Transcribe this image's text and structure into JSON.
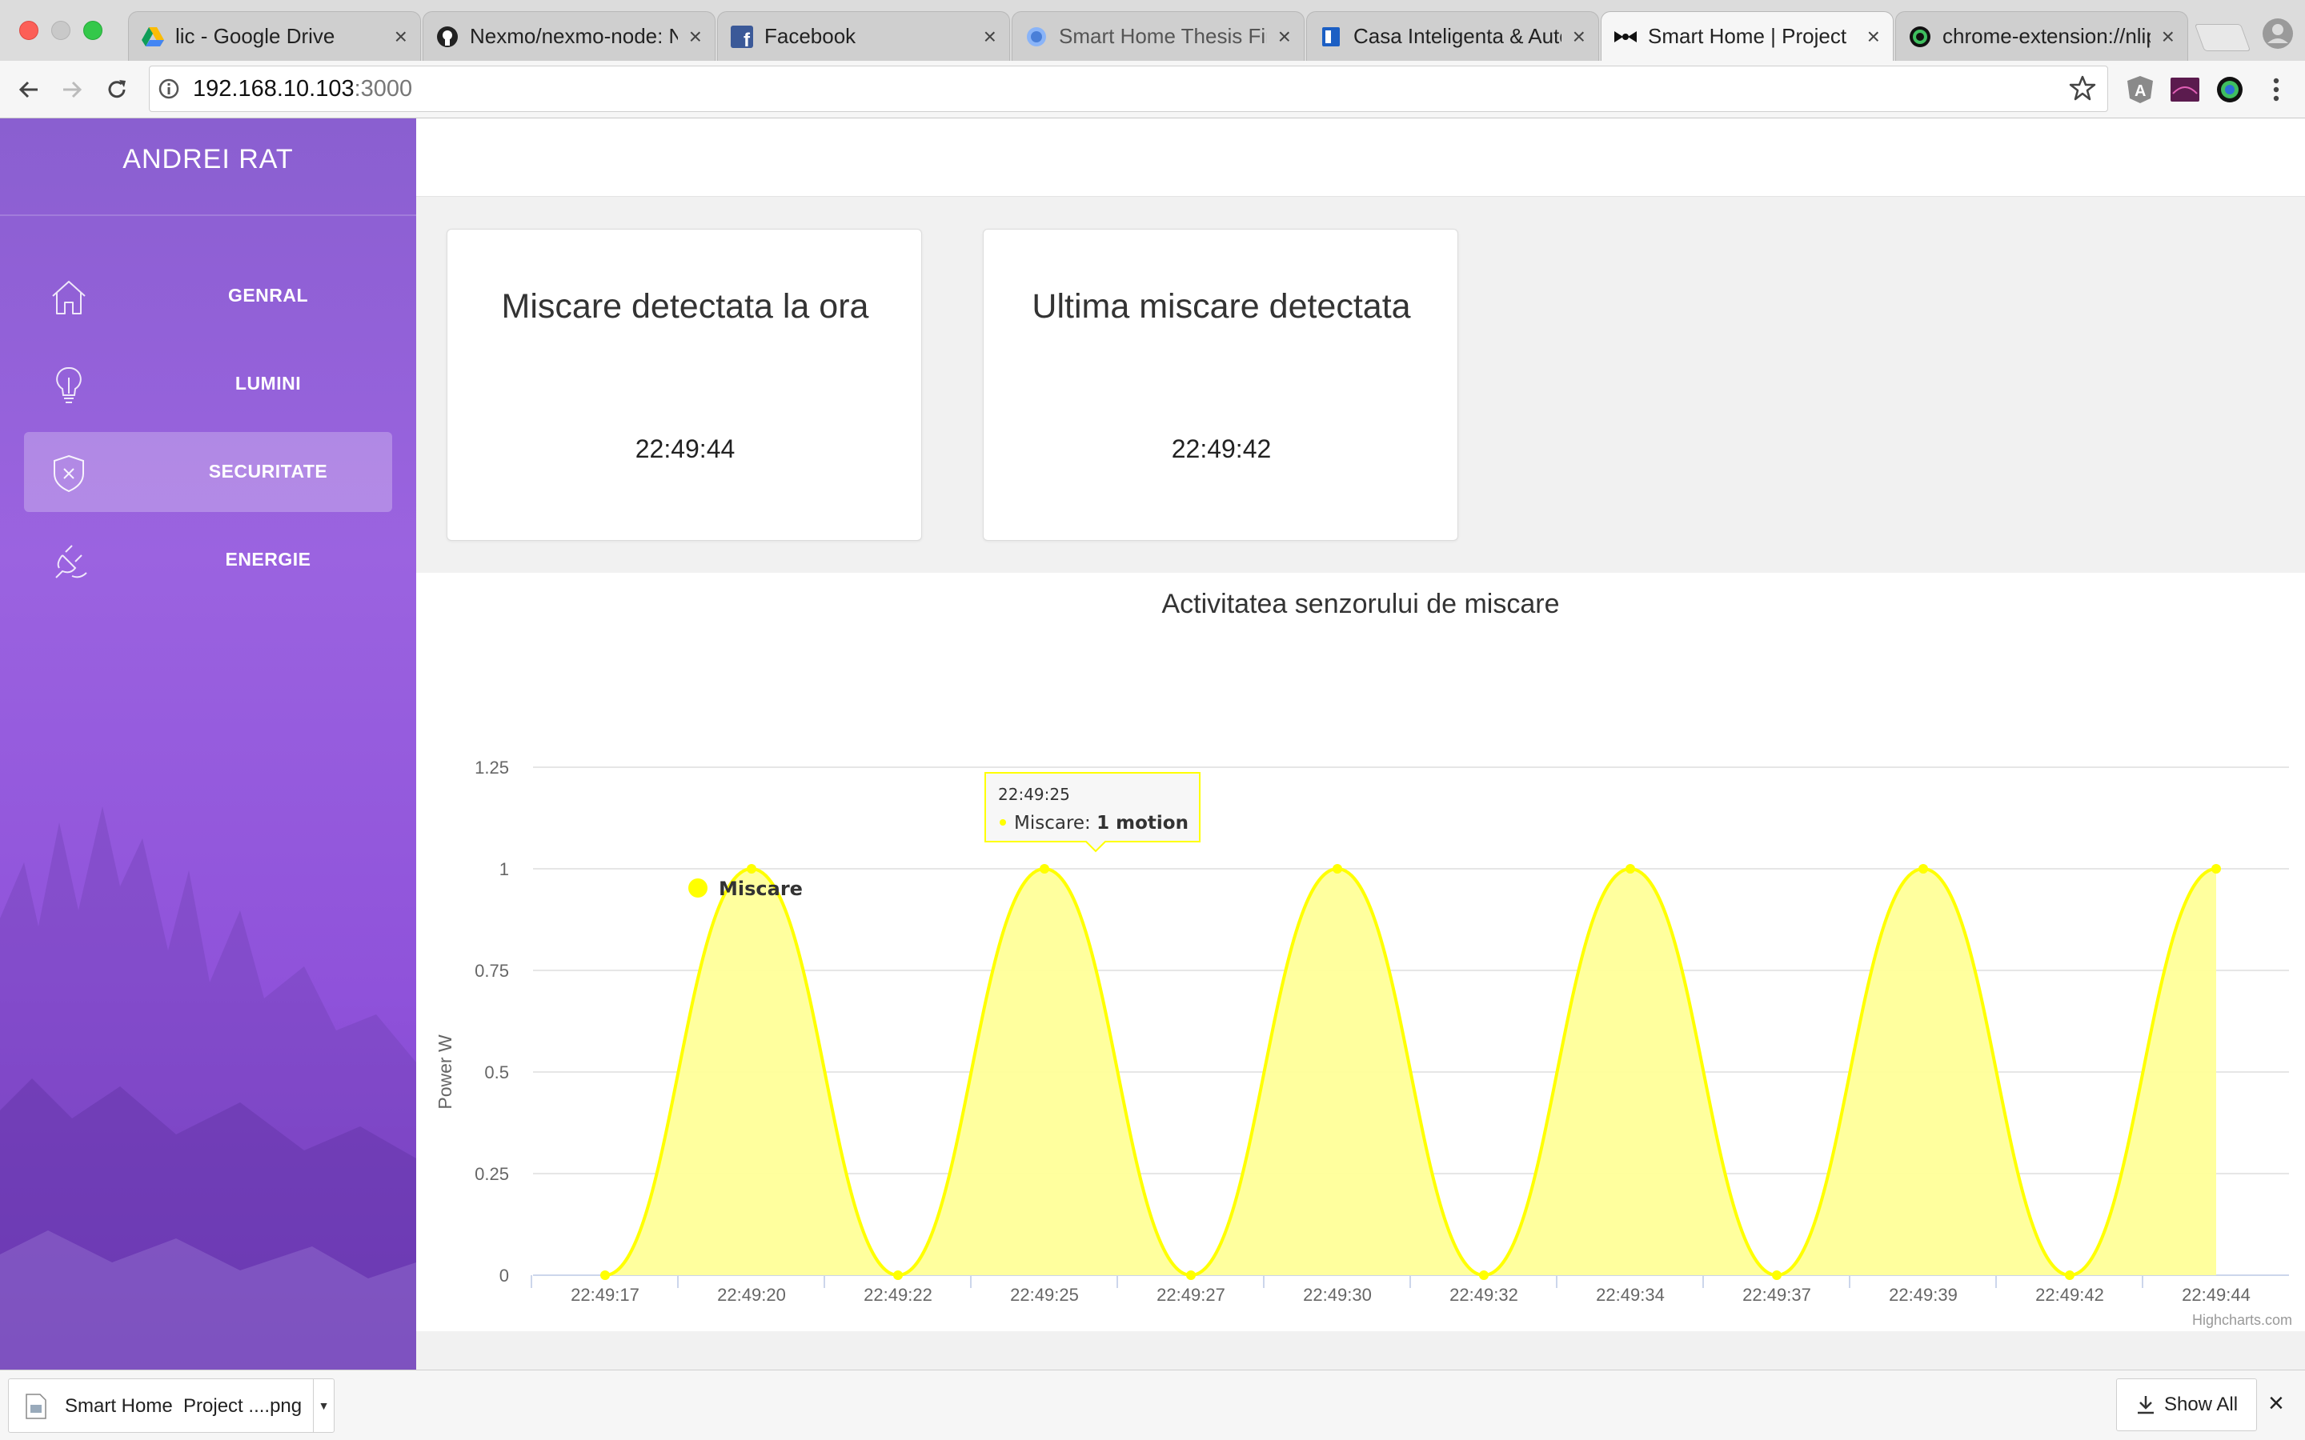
{
  "browser": {
    "tabs": [
      {
        "title": "lic - Google Drive",
        "icon": "google-drive-icon"
      },
      {
        "title": "Nexmo/nexmo-node: N",
        "icon": "github-icon"
      },
      {
        "title": "Facebook",
        "icon": "facebook-icon"
      },
      {
        "title": "Smart Home Thesis Fin",
        "icon": "docs-icon"
      },
      {
        "title": "Casa Inteligenta & Autc",
        "icon": "trello-icon"
      },
      {
        "title": "Smart Home | Project",
        "icon": "bowtie-icon",
        "active": true
      },
      {
        "title": "chrome-extension://nlip",
        "icon": "extension-icon"
      }
    ],
    "url_host": "192.168.10.103",
    "url_port": ":3000"
  },
  "sidebar": {
    "user_name": "ANDREI RAT",
    "items": [
      {
        "label": "GENRAL",
        "icon": "home-icon"
      },
      {
        "label": "LUMINI",
        "icon": "lightbulb-icon"
      },
      {
        "label": "SECURITATE",
        "icon": "shield-icon",
        "active": true
      },
      {
        "label": "ENERGIE",
        "icon": "plug-icon"
      }
    ]
  },
  "cards": [
    {
      "title": "Miscare detectata la ora",
      "value": "22:49:44"
    },
    {
      "title": "Ultima miscare detectata",
      "value": "22:49:42"
    }
  ],
  "chart_data": {
    "type": "area",
    "title": "Activitatea senzorului de miscare",
    "xlabel": "",
    "ylabel": "Power W",
    "ylim": [
      0,
      1.25
    ],
    "yticks": [
      "0",
      "0.25",
      "0.5",
      "0.75",
      "1",
      "1.25"
    ],
    "categories": [
      "22:49:17",
      "22:49:20",
      "22:49:22",
      "22:49:25",
      "22:49:27",
      "22:49:30",
      "22:49:32",
      "22:49:34",
      "22:49:37",
      "22:49:39",
      "22:49:42",
      "22:49:44"
    ],
    "series": [
      {
        "name": "Miscare",
        "values": [
          0,
          1,
          0,
          1,
          0,
          1,
          0,
          1,
          0,
          1,
          0,
          1
        ],
        "color": "#ffff00",
        "fill": "#ffff99"
      }
    ],
    "legend": "top-left inside plot",
    "grid": true,
    "credits": "Highcharts.com",
    "tooltip": {
      "time": "22:49:25",
      "series": "Miscare",
      "sep": ": ",
      "value": "1 motion"
    }
  },
  "downloads": {
    "file_name": "Smart Home  Project ....png",
    "show_all": "Show All"
  }
}
